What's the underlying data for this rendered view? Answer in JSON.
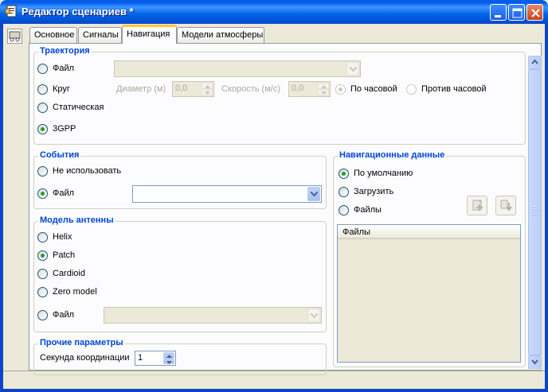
{
  "window": {
    "title": "Редактор сценариев *",
    "colors": {
      "titlebar": "#0058EE",
      "accent": "#0046D5",
      "face": "#ECE9D8",
      "radio_check": "#21A121",
      "tab_highlight": "#FFC83C"
    }
  },
  "tabs": [
    {
      "label": "Основное",
      "active": false
    },
    {
      "label": "Сигналы",
      "active": false
    },
    {
      "label": "Навигация",
      "active": true
    },
    {
      "label": "Модели атмосферы",
      "active": false
    }
  ],
  "trajectory": {
    "title": "Траектория",
    "options": [
      {
        "label": "Файл",
        "checked": false
      },
      {
        "label": "Круг",
        "checked": false
      },
      {
        "label": "Статическая",
        "checked": false
      },
      {
        "label": "3GPP",
        "checked": true
      }
    ],
    "file_value": "",
    "diameter_label": "Диаметр (м)",
    "diameter_value": "0,0",
    "speed_label": "Скорость (м/с)",
    "speed_value": "0,0",
    "clockwise_label": "По часовой",
    "clockwise_checked": true,
    "counterclockwise_label": "Против часовой",
    "counterclockwise_checked": false
  },
  "events": {
    "title": "События",
    "options": [
      {
        "label": "Не использовать",
        "checked": false
      },
      {
        "label": "Файл",
        "checked": true
      }
    ],
    "file_value": ""
  },
  "antenna": {
    "title": "Модель антенны",
    "options": [
      {
        "label": "Helix",
        "checked": false
      },
      {
        "label": "Patch",
        "checked": true
      },
      {
        "label": "Cardioid",
        "checked": false
      },
      {
        "label": "Zero model",
        "checked": false
      },
      {
        "label": "Файл",
        "checked": false
      }
    ],
    "file_value": ""
  },
  "other": {
    "title": "Прочие параметры",
    "second_label": "Секунда координации",
    "second_value": "1"
  },
  "navdata": {
    "title": "Навигационные данные",
    "options": [
      {
        "label": "По умолчанию",
        "checked": true
      },
      {
        "label": "Загрузить",
        "checked": false
      },
      {
        "label": "Файлы",
        "checked": false
      }
    ],
    "files_column": "Файлы"
  },
  "icons": [
    "app-document-icon",
    "minimize-icon",
    "maximize-icon",
    "close-icon",
    "dropdown-arrow-icon",
    "spin-up-icon",
    "spin-down-icon",
    "add-file-icon",
    "download-icon",
    "scroll-up-icon",
    "scroll-down-icon"
  ]
}
